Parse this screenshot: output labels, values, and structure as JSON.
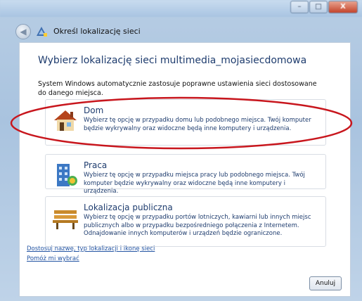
{
  "window": {
    "minimize": "–",
    "maximize": "□",
    "close": "X"
  },
  "nav": {
    "back": "◀",
    "title": "Określ lokalizację sieci"
  },
  "main": {
    "heading": "Wybierz lokalizację sieci multimedia_mojasieсdomowa",
    "description": "System Windows automatycznie zastosuje poprawne ustawienia sieci dostosowane do danego miejsca.",
    "options": [
      {
        "title": "Dom",
        "text": "Wybierz tę opcję w przypadku domu lub podobnego miejsca. Twój komputer będzie wykrywalny oraz widoczne będą inne komputery i urządzenia."
      },
      {
        "title": "Praca",
        "text": "Wybierz tę opcję w przypadku miejsca pracy lub podobnego miejsca. Twój komputer będzie wykrywalny oraz widoczne będą inne komputery i urządzenia."
      },
      {
        "title": "Lokalizacja publiczna",
        "text": "Wybierz tę opcję w przypadku portów lotniczych, kawiarni lub innych miejsc publicznych albo w przypadku bezpośredniego połączenia z Internetem. Odnajdowanie innych komputerów i urządzeń będzie ograniczone."
      }
    ],
    "links": [
      "Dostosuj nazwę, typ lokalizacji i ikonę sieci",
      "Pomóż mi wybrać"
    ],
    "cancel": "Anuluj"
  },
  "colors": {
    "heading": "#1e3c6e",
    "link": "#2354a3",
    "highlight": "#c8161d"
  }
}
